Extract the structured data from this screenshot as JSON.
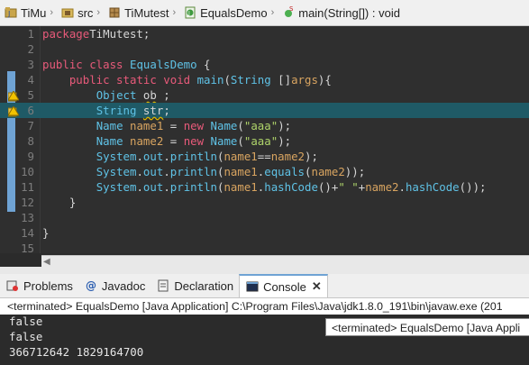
{
  "breadcrumb": {
    "items": [
      {
        "label": "TiMu",
        "icon": "project-icon"
      },
      {
        "label": "src",
        "icon": "source-folder-icon"
      },
      {
        "label": "TiMutest",
        "icon": "package-icon"
      },
      {
        "label": "EqualsDemo",
        "icon": "class-file-icon"
      },
      {
        "label": "main(String[]) : void",
        "icon": "method-icon"
      }
    ]
  },
  "editor": {
    "active_line": 6,
    "warning_lines": [
      5,
      6
    ],
    "lines": [
      {
        "n": "1",
        "tokens": [
          [
            "kw",
            "package"
          ],
          [
            "",
            "TiMutest;"
          ]
        ]
      },
      {
        "n": "2",
        "tokens": []
      },
      {
        "n": "3",
        "tokens": [
          [
            "kw",
            "public class"
          ],
          [
            "ty",
            " EqualsDemo"
          ],
          [
            "",
            " {"
          ]
        ]
      },
      {
        "n": "4",
        "tokens": [
          [
            "",
            "    "
          ],
          [
            "kw",
            "public static void"
          ],
          [
            "ty",
            " main"
          ],
          [
            "",
            "("
          ],
          [
            "ty",
            "String"
          ],
          [
            "",
            " []"
          ],
          [
            "var",
            "args"
          ],
          [
            "",
            ")"
          ],
          [
            "",
            "{"
          ]
        ]
      },
      {
        "n": "5",
        "tokens": [
          [
            "",
            "        "
          ],
          [
            "ty",
            "Object"
          ],
          [
            "",
            " "
          ],
          [
            "sq",
            "ob"
          ],
          [
            "",
            " ;"
          ]
        ]
      },
      {
        "n": "6",
        "tokens": [
          [
            "",
            "        "
          ],
          [
            "ty",
            "String"
          ],
          [
            "",
            " "
          ],
          [
            "sq",
            "str"
          ],
          [
            "",
            ";"
          ]
        ]
      },
      {
        "n": "7",
        "tokens": [
          [
            "",
            "        "
          ],
          [
            "ty",
            "Name"
          ],
          [
            "",
            " "
          ],
          [
            "var",
            "name1"
          ],
          [
            "",
            " = "
          ],
          [
            "kw",
            "new"
          ],
          [
            "ty",
            " Name"
          ],
          [
            "",
            "("
          ],
          [
            "st",
            "\"aaa\""
          ],
          [
            "",
            ");"
          ]
        ]
      },
      {
        "n": "8",
        "tokens": [
          [
            "",
            "        "
          ],
          [
            "ty",
            "Name"
          ],
          [
            "",
            " "
          ],
          [
            "var",
            "name2"
          ],
          [
            "",
            " = "
          ],
          [
            "kw",
            "new"
          ],
          [
            "ty",
            " Name"
          ],
          [
            "",
            "("
          ],
          [
            "st",
            "\"aaa\""
          ],
          [
            "",
            ");"
          ]
        ]
      },
      {
        "n": "9",
        "tokens": [
          [
            "",
            "        "
          ],
          [
            "ty",
            "System"
          ],
          [
            "",
            "."
          ],
          [
            "ty",
            "out"
          ],
          [
            "",
            "."
          ],
          [
            "ty",
            "println"
          ],
          [
            "",
            "("
          ],
          [
            "var",
            "name1"
          ],
          [
            "",
            "=="
          ],
          [
            "var",
            "name2"
          ],
          [
            "",
            ");"
          ]
        ]
      },
      {
        "n": "10",
        "tokens": [
          [
            "",
            "        "
          ],
          [
            "ty",
            "System"
          ],
          [
            "",
            "."
          ],
          [
            "ty",
            "out"
          ],
          [
            "",
            "."
          ],
          [
            "ty",
            "println"
          ],
          [
            "",
            "("
          ],
          [
            "var",
            "name1"
          ],
          [
            "",
            "."
          ],
          [
            "ty",
            "equals"
          ],
          [
            "",
            "("
          ],
          [
            "var",
            "name2"
          ],
          [
            "",
            "));"
          ]
        ]
      },
      {
        "n": "11",
        "tokens": [
          [
            "",
            "        "
          ],
          [
            "ty",
            "System"
          ],
          [
            "",
            "."
          ],
          [
            "ty",
            "out"
          ],
          [
            "",
            "."
          ],
          [
            "ty",
            "println"
          ],
          [
            "",
            "("
          ],
          [
            "var",
            "name1"
          ],
          [
            "",
            "."
          ],
          [
            "ty",
            "hashCode"
          ],
          [
            "",
            "()+"
          ],
          [
            "st",
            "\" \""
          ],
          [
            "",
            "+"
          ],
          [
            "var",
            "name2"
          ],
          [
            "",
            "."
          ],
          [
            "ty",
            "hashCode"
          ],
          [
            "",
            "());"
          ]
        ]
      },
      {
        "n": "12",
        "tokens": [
          [
            "",
            "    }"
          ]
        ]
      },
      {
        "n": "13",
        "tokens": []
      },
      {
        "n": "14",
        "tokens": [
          [
            "",
            "}"
          ]
        ]
      },
      {
        "n": "15",
        "tokens": []
      }
    ]
  },
  "panel": {
    "tabs": [
      {
        "label": "Problems",
        "icon": "problems-icon"
      },
      {
        "label": "Javadoc",
        "icon": "javadoc-icon"
      },
      {
        "label": "Declaration",
        "icon": "declaration-icon"
      },
      {
        "label": "Console",
        "icon": "console-icon",
        "selected": true
      }
    ],
    "close_symbol": "✕",
    "console_header": "<terminated> EqualsDemo [Java Application] C:\\Program Files\\Java\\jdk1.8.0_191\\bin\\javaw.exe (201",
    "tooltip": "<terminated> EqualsDemo [Java Appli",
    "output": [
      "false",
      "false",
      "366712642 1829164700"
    ]
  },
  "colors": {
    "keyword": "#e85a7a",
    "type": "#5fc2e6",
    "string": "#aed36a",
    "variable": "#d8a460",
    "active_line": "#1f5a66",
    "diff_bar": "#6fa3d4"
  }
}
